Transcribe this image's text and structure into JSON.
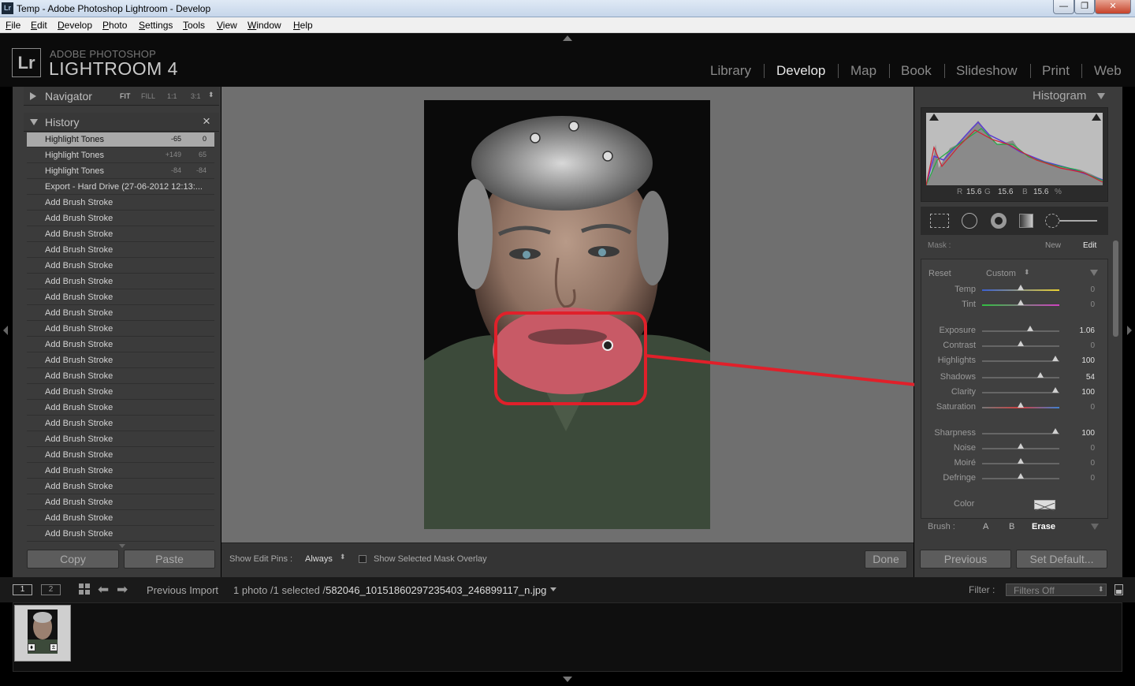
{
  "window": {
    "title": "Temp - Adobe Photoshop Lightroom - Develop",
    "controls": [
      "—",
      "❐",
      "✕"
    ]
  },
  "menu": [
    "File",
    "Edit",
    "Develop",
    "Photo",
    "Settings",
    "Tools",
    "View",
    "Window",
    "Help"
  ],
  "identity": {
    "logo": "Lr",
    "brand_top": "ADOBE PHOTOSHOP",
    "brand_name": "LIGHTROOM 4"
  },
  "modules": [
    "Library",
    "Develop",
    "Map",
    "Book",
    "Slideshow",
    "Print",
    "Web"
  ],
  "active_module": "Develop",
  "navigator": {
    "title": "Navigator",
    "zoom": [
      "FIT",
      "FILL",
      "1:1",
      "3:1"
    ]
  },
  "history": {
    "title": "History",
    "close": "×",
    "items": [
      {
        "label": "Highlight Tones",
        "v1": "-65",
        "v2": "0"
      },
      {
        "label": "Highlight Tones",
        "v1": "+149",
        "v2": "65"
      },
      {
        "label": "Highlight Tones",
        "v1": "-84",
        "v2": "-84"
      },
      {
        "label": "Export - Hard Drive (27-06-2012 12:13:...",
        "v1": "",
        "v2": ""
      },
      {
        "label": "Add Brush Stroke",
        "v1": "",
        "v2": ""
      },
      {
        "label": "Add Brush Stroke",
        "v1": "",
        "v2": ""
      },
      {
        "label": "Add Brush Stroke",
        "v1": "",
        "v2": ""
      },
      {
        "label": "Add Brush Stroke",
        "v1": "",
        "v2": ""
      },
      {
        "label": "Add Brush Stroke",
        "v1": "",
        "v2": ""
      },
      {
        "label": "Add Brush Stroke",
        "v1": "",
        "v2": ""
      },
      {
        "label": "Add Brush Stroke",
        "v1": "",
        "v2": ""
      },
      {
        "label": "Add Brush Stroke",
        "v1": "",
        "v2": ""
      },
      {
        "label": "Add Brush Stroke",
        "v1": "",
        "v2": ""
      },
      {
        "label": "Add Brush Stroke",
        "v1": "",
        "v2": ""
      },
      {
        "label": "Add Brush Stroke",
        "v1": "",
        "v2": ""
      },
      {
        "label": "Add Brush Stroke",
        "v1": "",
        "v2": ""
      },
      {
        "label": "Add Brush Stroke",
        "v1": "",
        "v2": ""
      },
      {
        "label": "Add Brush Stroke",
        "v1": "",
        "v2": ""
      },
      {
        "label": "Add Brush Stroke",
        "v1": "",
        "v2": ""
      },
      {
        "label": "Add Brush Stroke",
        "v1": "",
        "v2": ""
      },
      {
        "label": "Add Brush Stroke",
        "v1": "",
        "v2": ""
      },
      {
        "label": "Add Brush Stroke",
        "v1": "",
        "v2": ""
      },
      {
        "label": "Add Brush Stroke",
        "v1": "",
        "v2": ""
      },
      {
        "label": "Add Brush Stroke",
        "v1": "",
        "v2": ""
      },
      {
        "label": "Add Brush Stroke",
        "v1": "",
        "v2": ""
      },
      {
        "label": "Add Brush Stroke",
        "v1": "",
        "v2": ""
      }
    ]
  },
  "left_buttons": {
    "copy": "Copy",
    "paste": "Paste"
  },
  "toolbar": {
    "pins_label": "Show Edit Pins :",
    "pins_value": "Always",
    "overlay_label": "Show Selected Mask Overlay",
    "done": "Done"
  },
  "histogram": {
    "title": "Histogram",
    "r_label": "R",
    "r": "15.6",
    "g_label": "G",
    "g": "15.6",
    "b_label": "B",
    "b": "15.6",
    "pct": "%"
  },
  "mask": {
    "label": "Mask :",
    "new": "New",
    "edit": "Edit"
  },
  "effect": {
    "reset": "Reset",
    "preset": "Custom"
  },
  "sliders": [
    {
      "label": "Temp",
      "value": "0",
      "pos": 0.5
    },
    {
      "label": "Tint",
      "value": "0",
      "pos": 0.5
    },
    {
      "label": "Exposure",
      "value": "1.06",
      "pos": 0.62
    },
    {
      "label": "Contrast",
      "value": "0",
      "pos": 0.5
    },
    {
      "label": "Highlights",
      "value": "100",
      "pos": 0.95
    },
    {
      "label": "Shadows",
      "value": "54",
      "pos": 0.75
    },
    {
      "label": "Clarity",
      "value": "100",
      "pos": 0.95
    },
    {
      "label": "Saturation",
      "value": "0",
      "pos": 0.5
    },
    {
      "label": "Sharpness",
      "value": "100",
      "pos": 0.95
    },
    {
      "label": "Noise",
      "value": "0",
      "pos": 0.5
    },
    {
      "label": "Moiré",
      "value": "0",
      "pos": 0.5
    },
    {
      "label": "Defringe",
      "value": "0",
      "pos": 0.5
    }
  ],
  "color_label": "Color",
  "brush": {
    "label": "Brush :",
    "a": "A",
    "b": "B",
    "erase": "Erase"
  },
  "right_buttons": {
    "previous": "Previous",
    "set_default": "Set Default..."
  },
  "filmbar": {
    "view1": "1",
    "view2": "2",
    "source": "Previous Import",
    "info_prefix": "1 photo /1 selected /",
    "filename": "582046_10151860297235403_246899117_n.jpg",
    "filter_label": "Filter :",
    "filter_value": "Filters Off"
  },
  "colors": {
    "highlight_red": "#e0202a",
    "panel_bg": "#3b3b3b",
    "canvas_bg": "#6f6f6f"
  }
}
